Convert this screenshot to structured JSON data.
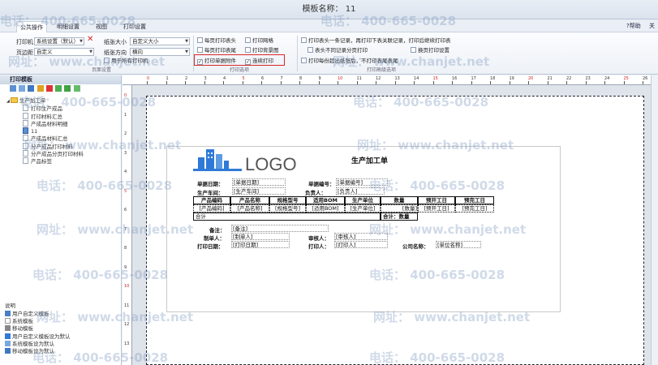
{
  "window": {
    "title": "模板名称： 11"
  },
  "tabs": [
    {
      "label": "公共操作",
      "active": true
    },
    {
      "label": "明细设置",
      "active": false
    },
    {
      "label": "视图",
      "active": false
    },
    {
      "label": "打印设置",
      "active": false
    }
  ],
  "right_tools": [
    "?帮助",
    "关"
  ],
  "ribbon": {
    "printer_label": "打印机",
    "printer_value": "系统设置（默认）",
    "paper_size_label": "纸张大小",
    "paper_size_value": "自定义大小",
    "paper_type_label": "页边距",
    "paper_type_value": "自定义",
    "orientation_label": "纸张方向",
    "orientation_value": "横向",
    "apply_all_label": "用于所有打印机",
    "group_page_label": "页面设置",
    "checks_print": [
      {
        "label": "每页打印表头",
        "checked": false
      },
      {
        "label": "每页打印表尾",
        "checked": false
      },
      {
        "label": "打印网格",
        "checked": false
      },
      {
        "label": "打印背景图",
        "checked": false
      },
      {
        "label": "打印单据附件",
        "checked": true
      },
      {
        "label": "连续打印",
        "checked": true
      }
    ],
    "group_print_label": "打印选项",
    "checks_adv": [
      {
        "label": "打印表头一条记录，再打印下表关联记录，打印后继续打印表",
        "checked": false
      },
      {
        "label": "表头不同记录分页打印",
        "checked": false
      },
      {
        "label": "换页打印设置",
        "checked": false
      },
      {
        "label": "打印每份超出纸张后，不打印表尾表尾",
        "checked": false
      }
    ],
    "group_adv_label": "打印高级选项"
  },
  "left_panel": {
    "title": "打印模板",
    "tree_root": "生产加工单",
    "tree_items": [
      "打印生产成品",
      "打印材料汇总",
      "产成品材料明细",
      "11",
      "产成品材料汇总",
      "分产成品打印材料",
      "分产成品分页打印材料",
      "产品标签"
    ],
    "help_title": "说明",
    "help_items": [
      "用户自定义模板",
      "系统模板",
      "移动模板",
      "用户自定义模板设为默认",
      "系统模板设为默认",
      "移动模板设为默认"
    ]
  },
  "ruler": {
    "h_ticks": [
      "0",
      "1",
      "2",
      "3",
      "4",
      "5",
      "6",
      "7",
      "8",
      "9",
      "10",
      "11",
      "12",
      "13",
      "14",
      "15",
      "16",
      "17",
      "18",
      "19",
      "20",
      "21",
      "22",
      "23",
      "24",
      "25",
      "26"
    ],
    "v_ticks": [
      "0",
      "1",
      "2",
      "3",
      "4",
      "5",
      "6",
      "7",
      "8",
      "9",
      "10",
      "11",
      "12",
      "13"
    ]
  },
  "report": {
    "logo_text": "LOGO",
    "title": "生产加工单",
    "doc_date_label": "单据日期：",
    "doc_date_field": "[单据日期]",
    "doc_no_label": "单据编号：",
    "doc_no_field": "[单据编号]",
    "workshop_label": "生产车间：",
    "workshop_field": "[生产车间]",
    "manager_label": "负责人：",
    "manager_field": "[负责人]",
    "columns": [
      "产品编码",
      "产品名称",
      "规格型号",
      "适用BOM",
      "生产单位",
      "数量",
      "预开工日",
      "预完工日"
    ],
    "row": [
      "[产品编码]",
      "[产品名称]",
      "[规格型号]",
      "[适用BOM]",
      "[生产单位]",
      "[数量]",
      "[预开工日]",
      "[预完工日]"
    ],
    "total_label": "合计",
    "total_qty_label": "合计：数量",
    "remark_label": "备注：",
    "remark_field": "[备注]",
    "maker_label": "制单人：",
    "maker_field": "[制单人]",
    "auditor_label": "审核人：",
    "auditor_field": "[审核人]",
    "print_date_label": "打印日期：",
    "print_date_field": "[打印日期]",
    "printer_label": "打印人：",
    "printer_field": "[打印人]",
    "company_label": "公司名称：",
    "company_field": "[单位名称]"
  },
  "watermark": {
    "phone": "电话： 400-665-0028",
    "site": "网址： www.chanjet.net"
  },
  "colors": {
    "accent": "#d9262a",
    "logo_blue": "#2f7ad8",
    "logo_text": "#555555"
  }
}
